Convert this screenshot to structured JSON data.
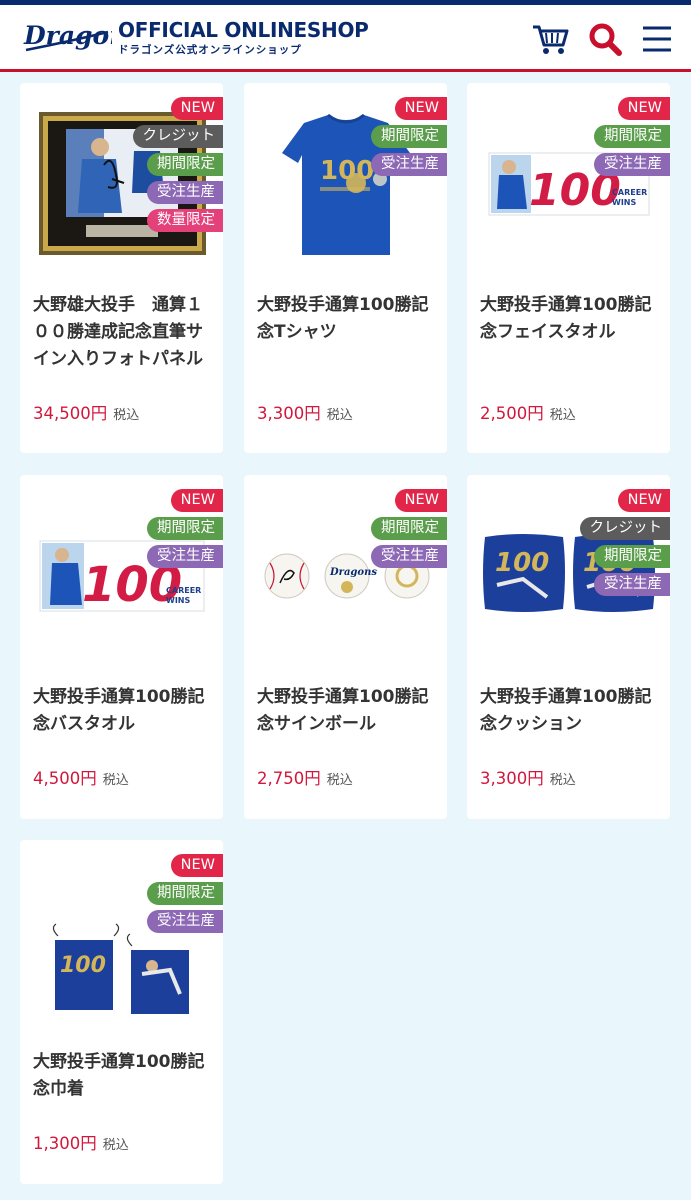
{
  "header": {
    "logo_text": "Dragons",
    "title": "OFFICIAL ONLINESHOP",
    "subtitle": "ドラゴンズ公式オンラインショップ",
    "icons": [
      "cart-icon",
      "search-icon",
      "menu-icon"
    ]
  },
  "colors": {
    "navy": "#0a2a6e",
    "red": "#c8102e",
    "badge_new": "#e2264a",
    "badge_credit": "#5c5c5c",
    "badge_limited": "#5a9e4b",
    "badge_order": "#8c68b5",
    "badge_qty": "#e4407a",
    "price": "#d3173c",
    "background": "#e9f6fc"
  },
  "tax_label": "税込",
  "products": [
    {
      "name": "大野雄大投手　通算１００勝達成記念直筆サイン入りフォトパネル",
      "price": "34,500円",
      "badges": [
        "NEW",
        "クレジット",
        "期間限定",
        "受注生産",
        "数量限定"
      ],
      "image": "framed-photo-panel"
    },
    {
      "name": "大野投手通算100勝記念Tシャツ",
      "price": "3,300円",
      "badges": [
        "NEW",
        "期間限定",
        "受注生産"
      ],
      "image": "t-shirt"
    },
    {
      "name": "大野投手通算100勝記念フェイスタオル",
      "price": "2,500円",
      "badges": [
        "NEW",
        "期間限定",
        "受注生産"
      ],
      "image": "face-towel"
    },
    {
      "name": "大野投手通算100勝記念バスタオル",
      "price": "4,500円",
      "badges": [
        "NEW",
        "期間限定",
        "受注生産"
      ],
      "image": "bath-towel"
    },
    {
      "name": "大野投手通算100勝記念サインボール",
      "price": "2,750円",
      "badges": [
        "NEW",
        "期間限定",
        "受注生産"
      ],
      "image": "signed-balls"
    },
    {
      "name": "大野投手通算100勝記念クッション",
      "price": "3,300円",
      "badges": [
        "NEW",
        "クレジット",
        "期間限定",
        "受注生産"
      ],
      "image": "cushions"
    },
    {
      "name": "大野投手通算100勝記念巾着",
      "price": "1,300円",
      "badges": [
        "NEW",
        "期間限定",
        "受注生産"
      ],
      "image": "drawstring-bags"
    }
  ]
}
